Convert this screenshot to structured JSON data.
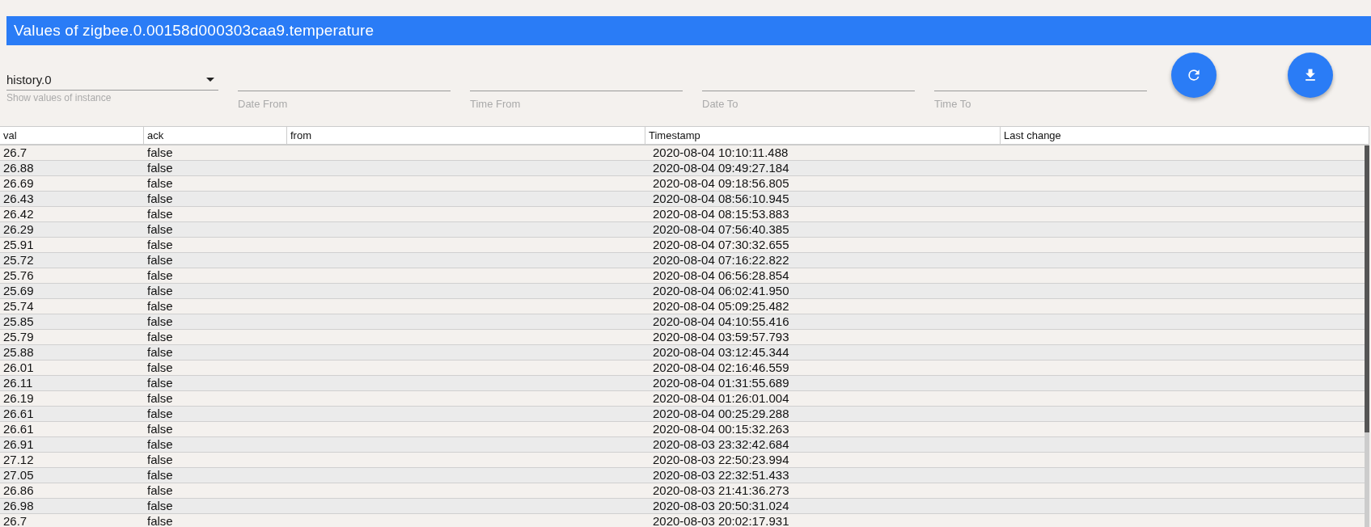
{
  "title": "Values of zigbee.0.00158d000303caa9.temperature",
  "instance": {
    "value": "history.0",
    "label": "Show values of instance"
  },
  "filters": [
    {
      "placeholder": "Date From"
    },
    {
      "placeholder": "Time From"
    },
    {
      "placeholder": "Date To"
    },
    {
      "placeholder": "Time To"
    }
  ],
  "table": {
    "columns": [
      "val",
      "ack",
      "from",
      "Timestamp",
      "Last change"
    ],
    "rows": [
      [
        "26.7",
        "false",
        "",
        "2020-08-04 10:10:11.488",
        ""
      ],
      [
        "26.88",
        "false",
        "",
        "2020-08-04 09:49:27.184",
        ""
      ],
      [
        "26.69",
        "false",
        "",
        "2020-08-04 09:18:56.805",
        ""
      ],
      [
        "26.43",
        "false",
        "",
        "2020-08-04 08:56:10.945",
        ""
      ],
      [
        "26.42",
        "false",
        "",
        "2020-08-04 08:15:53.883",
        ""
      ],
      [
        "26.29",
        "false",
        "",
        "2020-08-04 07:56:40.385",
        ""
      ],
      [
        "25.91",
        "false",
        "",
        "2020-08-04 07:30:32.655",
        ""
      ],
      [
        "25.72",
        "false",
        "",
        "2020-08-04 07:16:22.822",
        ""
      ],
      [
        "25.76",
        "false",
        "",
        "2020-08-04 06:56:28.854",
        ""
      ],
      [
        "25.69",
        "false",
        "",
        "2020-08-04 06:02:41.950",
        ""
      ],
      [
        "25.74",
        "false",
        "",
        "2020-08-04 05:09:25.482",
        ""
      ],
      [
        "25.85",
        "false",
        "",
        "2020-08-04 04:10:55.416",
        ""
      ],
      [
        "25.79",
        "false",
        "",
        "2020-08-04 03:59:57.793",
        ""
      ],
      [
        "25.88",
        "false",
        "",
        "2020-08-04 03:12:45.344",
        ""
      ],
      [
        "26.01",
        "false",
        "",
        "2020-08-04 02:16:46.559",
        ""
      ],
      [
        "26.11",
        "false",
        "",
        "2020-08-04 01:31:55.689",
        ""
      ],
      [
        "26.19",
        "false",
        "",
        "2020-08-04 01:26:01.004",
        ""
      ],
      [
        "26.61",
        "false",
        "",
        "2020-08-04 00:25:29.288",
        ""
      ],
      [
        "26.61",
        "false",
        "",
        "2020-08-04 00:15:32.263",
        ""
      ],
      [
        "26.91",
        "false",
        "",
        "2020-08-03 23:32:42.684",
        ""
      ],
      [
        "27.12",
        "false",
        "",
        "2020-08-03 22:50:23.994",
        ""
      ],
      [
        "27.05",
        "false",
        "",
        "2020-08-03 22:32:51.433",
        ""
      ],
      [
        "26.86",
        "false",
        "",
        "2020-08-03 21:41:36.273",
        ""
      ],
      [
        "26.98",
        "false",
        "",
        "2020-08-03 20:50:31.024",
        ""
      ],
      [
        "26.7",
        "false",
        "",
        "2020-08-03 20:02:17.931",
        ""
      ]
    ]
  }
}
